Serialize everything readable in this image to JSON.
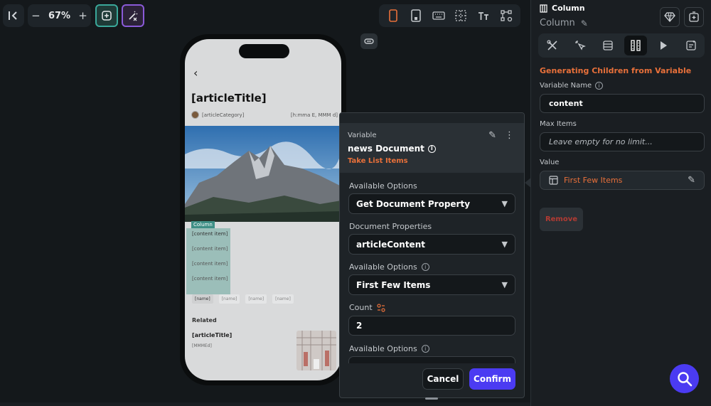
{
  "toolbar": {
    "zoom": "67%",
    "minus": "−",
    "plus": "+"
  },
  "phone": {
    "article_title": "[articleTitle]",
    "article_category": "[articleCategory]",
    "date_format": "[h:mma E, MMM d]",
    "column_tag": "Column",
    "content_items": [
      "[content item]",
      "[content item]",
      "[content item]",
      "[content item]"
    ],
    "name_chips": [
      "[name]",
      "[name]",
      "[name]",
      "[name]"
    ],
    "related_heading": "Related",
    "related_title": "[articleTitle]",
    "related_date": "[MMMEd]"
  },
  "popup": {
    "variable_label": "Variable",
    "variable_name": "news Document",
    "take_list_items": "Take List Items",
    "fields": [
      {
        "label": "Available Options",
        "value": "Get Document Property"
      },
      {
        "label": "Document Properties",
        "value": "articleContent"
      },
      {
        "label": "Available Options",
        "value": "First Few Items"
      }
    ],
    "count_label": "Count",
    "count_value": "2",
    "last_options_label": "Available Options",
    "cancel_label": "Cancel",
    "confirm_label": "Confirm"
  },
  "right_panel": {
    "widget_type": "Column",
    "widget_name": "Column",
    "section_title": "Generating Children from Variable",
    "variable_name_label": "Variable Name",
    "variable_name_value": "content",
    "max_items_label": "Max Items",
    "max_items_placeholder": "Leave empty for no limit...",
    "value_label": "Value",
    "value_text": "First Few Items",
    "remove_label": "Remove"
  },
  "colors": {
    "accent_orange": "#e8703a",
    "accent_purple": "#4b3bf2",
    "remove_red": "#b23b33",
    "teal": "#3f8f86"
  }
}
